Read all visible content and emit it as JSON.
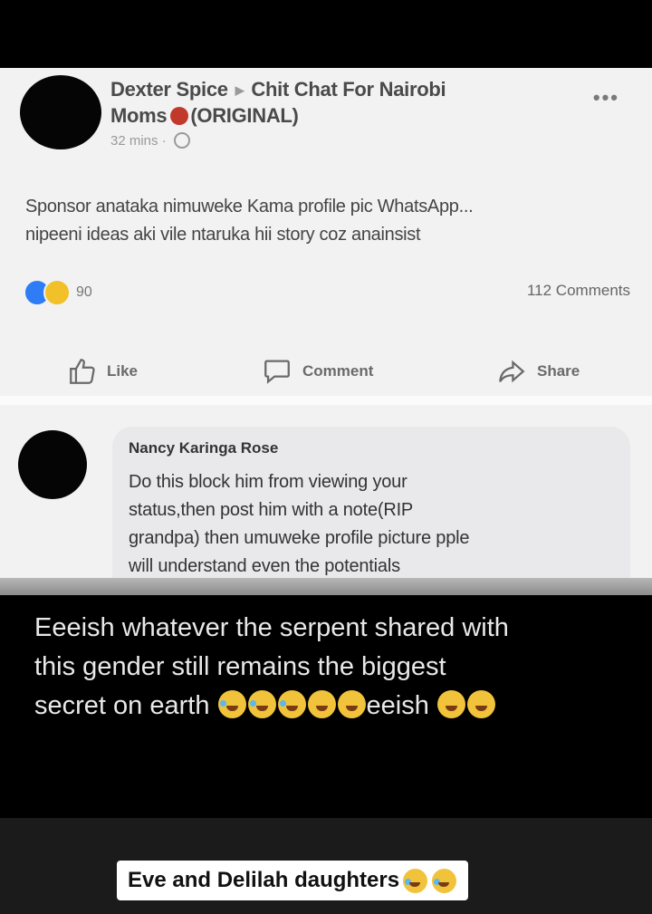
{
  "post": {
    "author": "Dexter Spice",
    "group_line1": "Chit Chat For Nairobi",
    "group_line2": "Moms",
    "group_tag": "(ORIGINAL)",
    "time": "32 mins",
    "more": "•••",
    "body_line1": "Sponsor anataka nimuweke Kama profile pic WhatsApp...",
    "body_line2": "nipeeni ideas aki vile ntaruka hii story coz anainsist",
    "reaction_count": "90",
    "comments_count": "112 Comments",
    "actions": {
      "like": "Like",
      "comment": "Comment",
      "share": "Share"
    }
  },
  "comment": {
    "author": "Nancy Karinga Rose",
    "line1": "Do this block him from viewing your",
    "line2": "status,then post him with a note(RIP",
    "line3": "grandpa) then umuweke profile picture pple",
    "line4": "will understand even the potentials"
  },
  "caption": {
    "line1": "Eeeish whatever the serpent shared with",
    "line2": "this gender still remains the biggest",
    "line3a": "secret on earth",
    "line3b": "eeish"
  },
  "sticker": {
    "text": "Eve and Delilah daughters"
  },
  "colors": {
    "like_blue": "#2e7cf6",
    "emoji_yellow": "#f1c33b",
    "group_badge_red": "#c0392b"
  }
}
